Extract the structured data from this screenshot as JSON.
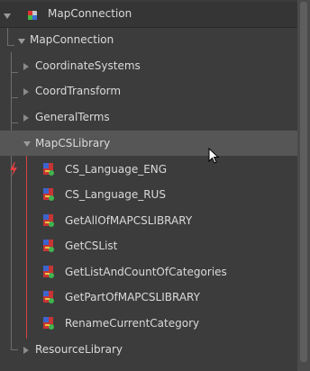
{
  "root": {
    "label": "MapConnection"
  },
  "group": {
    "label": "MapConnection"
  },
  "folders": [
    {
      "label": "CoordinateSystems"
    },
    {
      "label": "CoordTransform"
    },
    {
      "label": "GeneralTerms"
    },
    {
      "label": "MapCSLibrary"
    }
  ],
  "nodes": [
    {
      "label": "CS_Language_ENG"
    },
    {
      "label": "CS_Language_RUS"
    },
    {
      "label": "GetAllOfMAPCSLIBRARY"
    },
    {
      "label": "GetCSList"
    },
    {
      "label": "GetListAndCountOfCategories"
    },
    {
      "label": "GetPartOfMAPCSLIBRARY"
    },
    {
      "label": "RenameCurrentCategory"
    }
  ],
  "last_folder": {
    "label": "ResourceLibrary"
  },
  "colors": {
    "selected_row": "#565656",
    "active_branch": "#d64040"
  },
  "icons": {
    "root": "map-connection-icon",
    "node": "script-node-icon",
    "marker": "lightning-bolt-icon"
  }
}
